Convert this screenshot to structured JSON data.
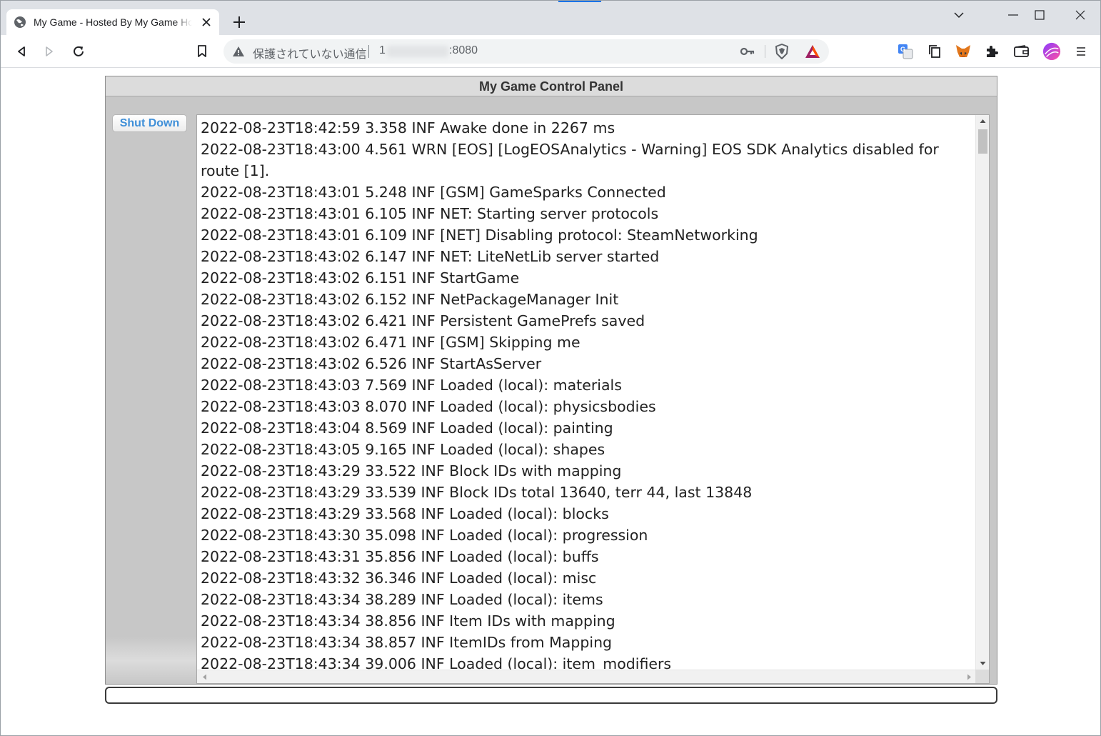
{
  "browser": {
    "tab": {
      "title": "My Game - Hosted By My Game Host",
      "close_icon": "close-icon"
    },
    "toolbar": {
      "security_label": "保護されていない通信",
      "url_prefix": "1",
      "url_suffix": ":8080"
    },
    "colors": {
      "tabstrip": "#dee1e6",
      "accent": "#1a73e8"
    }
  },
  "panel": {
    "title": "My Game Control Panel",
    "shutdown_label": "Shut Down",
    "command_placeholder": "",
    "log_lines": [
      "2022-08-23T18:42:59 3.358 INF Awake done in 2267 ms",
      "2022-08-23T18:43:00 4.561 WRN [EOS] [LogEOSAnalytics - Warning] EOS SDK Analytics disabled for route [1].",
      "2022-08-23T18:43:01 5.248 INF [GSM] GameSparks Connected",
      "2022-08-23T18:43:01 6.105 INF NET: Starting server protocols",
      "2022-08-23T18:43:01 6.109 INF [NET] Disabling protocol: SteamNetworking",
      "2022-08-23T18:43:02 6.147 INF NET: LiteNetLib server started",
      "2022-08-23T18:43:02 6.151 INF StartGame",
      "2022-08-23T18:43:02 6.152 INF NetPackageManager Init",
      "2022-08-23T18:43:02 6.421 INF Persistent GamePrefs saved",
      "2022-08-23T18:43:02 6.471 INF [GSM] Skipping me",
      "2022-08-23T18:43:02 6.526 INF StartAsServer",
      "2022-08-23T18:43:03 7.569 INF Loaded (local): materials",
      "2022-08-23T18:43:03 8.070 INF Loaded (local): physicsbodies",
      "2022-08-23T18:43:04 8.569 INF Loaded (local): painting",
      "2022-08-23T18:43:05 9.165 INF Loaded (local): shapes",
      "2022-08-23T18:43:29 33.522 INF Block IDs with mapping",
      "2022-08-23T18:43:29 33.539 INF Block IDs total 13640, terr 44, last 13848",
      "2022-08-23T18:43:29 33.568 INF Loaded (local): blocks",
      "2022-08-23T18:43:30 35.098 INF Loaded (local): progression",
      "2022-08-23T18:43:31 35.856 INF Loaded (local): buffs",
      "2022-08-23T18:43:32 36.346 INF Loaded (local): misc",
      "2022-08-23T18:43:34 38.289 INF Loaded (local): items",
      "2022-08-23T18:43:34 38.856 INF Item IDs with mapping",
      "2022-08-23T18:43:34 38.857 INF ItemIDs from Mapping",
      "2022-08-23T18:43:34 39.006 INF Loaded (local): item_modifiers"
    ]
  }
}
